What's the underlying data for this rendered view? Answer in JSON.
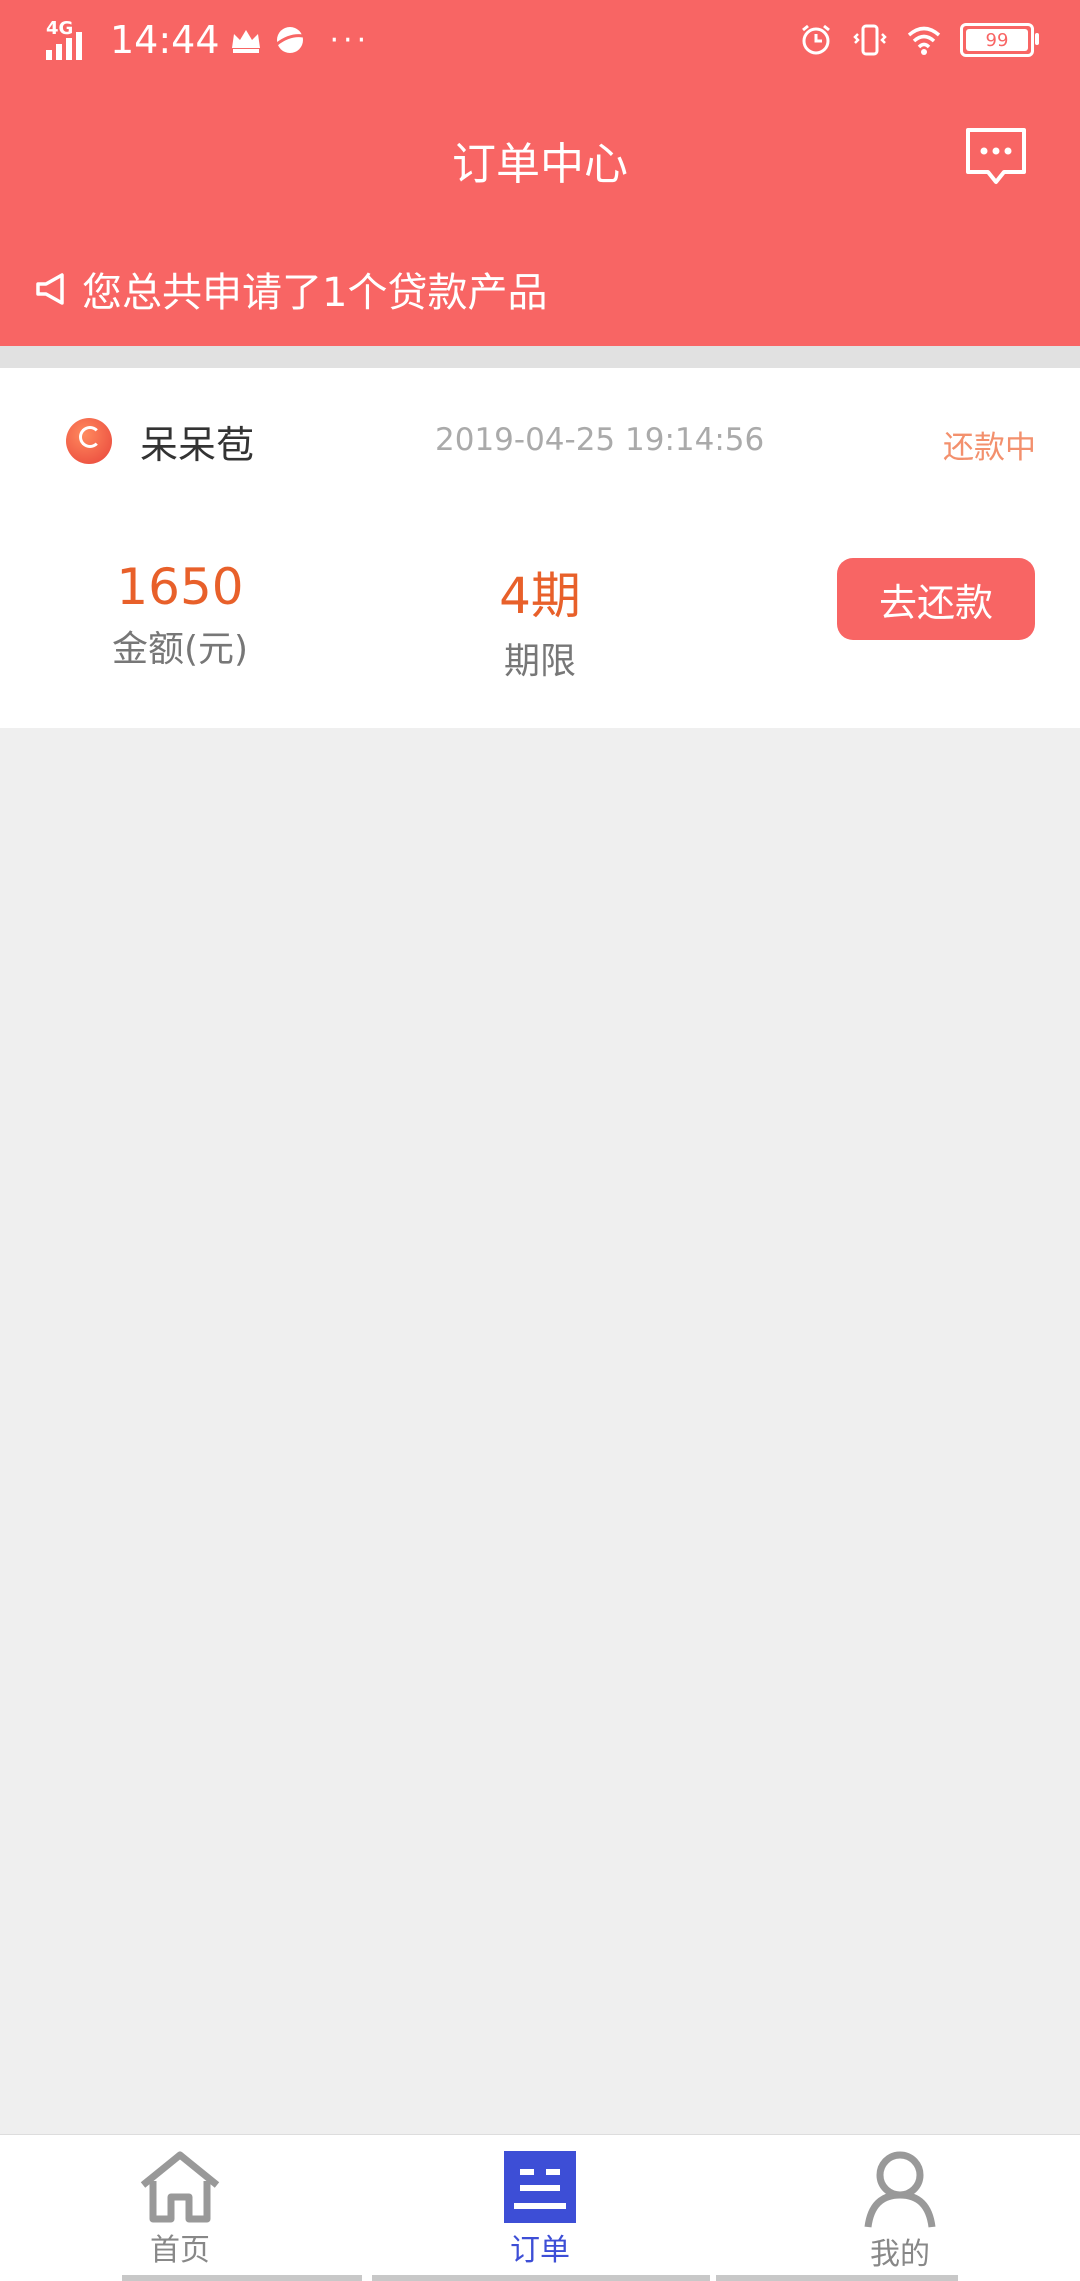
{
  "status_bar": {
    "network": "4G",
    "time": "14:44",
    "more": "···",
    "battery": "99"
  },
  "header": {
    "title": "订单中心",
    "message_icon": "message-dots-icon",
    "notice": "您总共申请了1个贷款产品"
  },
  "order": {
    "lender_name": "呆呆苞",
    "date": "2019-04-25 19:14:56",
    "status": "还款中",
    "amount_value": "1650",
    "amount_label": "金额(元)",
    "period_value": "4期",
    "period_label": "期限",
    "repay_button": "去还款"
  },
  "tabbar": {
    "items": [
      {
        "label": "首页",
        "icon": "home-icon"
      },
      {
        "label": "订单",
        "icon": "order-icon",
        "active": true
      },
      {
        "label": "我的",
        "icon": "profile-icon"
      }
    ]
  },
  "colors": {
    "brand": "#f86564",
    "accent_orange": "#e8602a",
    "tab_active": "#3d4ed6"
  }
}
